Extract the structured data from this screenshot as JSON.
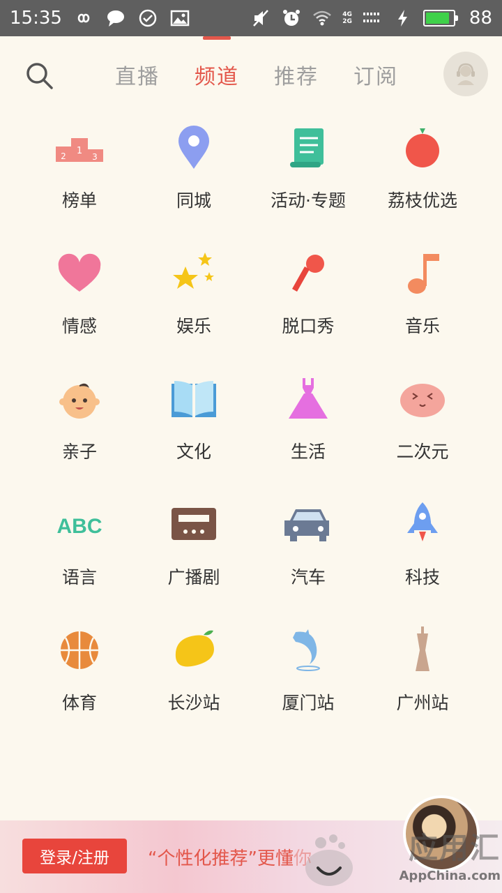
{
  "status_bar": {
    "time": "15:35",
    "net_top": "4G",
    "net_bottom": "2G",
    "battery_level": "88",
    "battery_fill_fraction": 0.88,
    "icons": [
      "infinity-icon",
      "chat-bubble-icon",
      "check-circle-icon",
      "image-icon",
      "mute-icon",
      "alarm-icon",
      "wifi-icon",
      "signal-icon",
      "charging-icon",
      "battery-icon"
    ]
  },
  "header": {
    "tabs": [
      {
        "label": "直播",
        "active": false
      },
      {
        "label": "频道",
        "active": true
      },
      {
        "label": "推荐",
        "active": false
      },
      {
        "label": "订阅",
        "active": false
      }
    ],
    "accent_color": "#e3574b"
  },
  "channels": [
    {
      "label": "榜单",
      "icon": "podium-icon"
    },
    {
      "label": "同城",
      "icon": "location-pin-icon"
    },
    {
      "label": "活动·专题",
      "icon": "scroll-icon"
    },
    {
      "label": "荔枝优选",
      "icon": "lychee-icon"
    },
    {
      "label": "情感",
      "icon": "heart-icon"
    },
    {
      "label": "娱乐",
      "icon": "stars-icon"
    },
    {
      "label": "脱口秀",
      "icon": "microphone-icon"
    },
    {
      "label": "音乐",
      "icon": "music-note-icon"
    },
    {
      "label": "亲子",
      "icon": "baby-face-icon"
    },
    {
      "label": "文化",
      "icon": "open-book-icon"
    },
    {
      "label": "生活",
      "icon": "dress-icon"
    },
    {
      "label": "二次元",
      "icon": "cute-face-icon"
    },
    {
      "label": "语言",
      "icon": "abc-icon",
      "glyph": "ABC"
    },
    {
      "label": "广播剧",
      "icon": "radio-icon"
    },
    {
      "label": "汽车",
      "icon": "car-icon"
    },
    {
      "label": "科技",
      "icon": "rocket-icon"
    },
    {
      "label": "体育",
      "icon": "basketball-icon"
    },
    {
      "label": "长沙站",
      "icon": "mango-icon"
    },
    {
      "label": "厦门站",
      "icon": "dolphin-icon"
    },
    {
      "label": "广州站",
      "icon": "canton-tower-icon"
    }
  ],
  "banner": {
    "login_label": "登录/注册",
    "slogan": "“个性化推荐”更懂",
    "slogan_tail": "你"
  },
  "watermark": {
    "cn": "应用汇",
    "en": "AppChina.com"
  }
}
